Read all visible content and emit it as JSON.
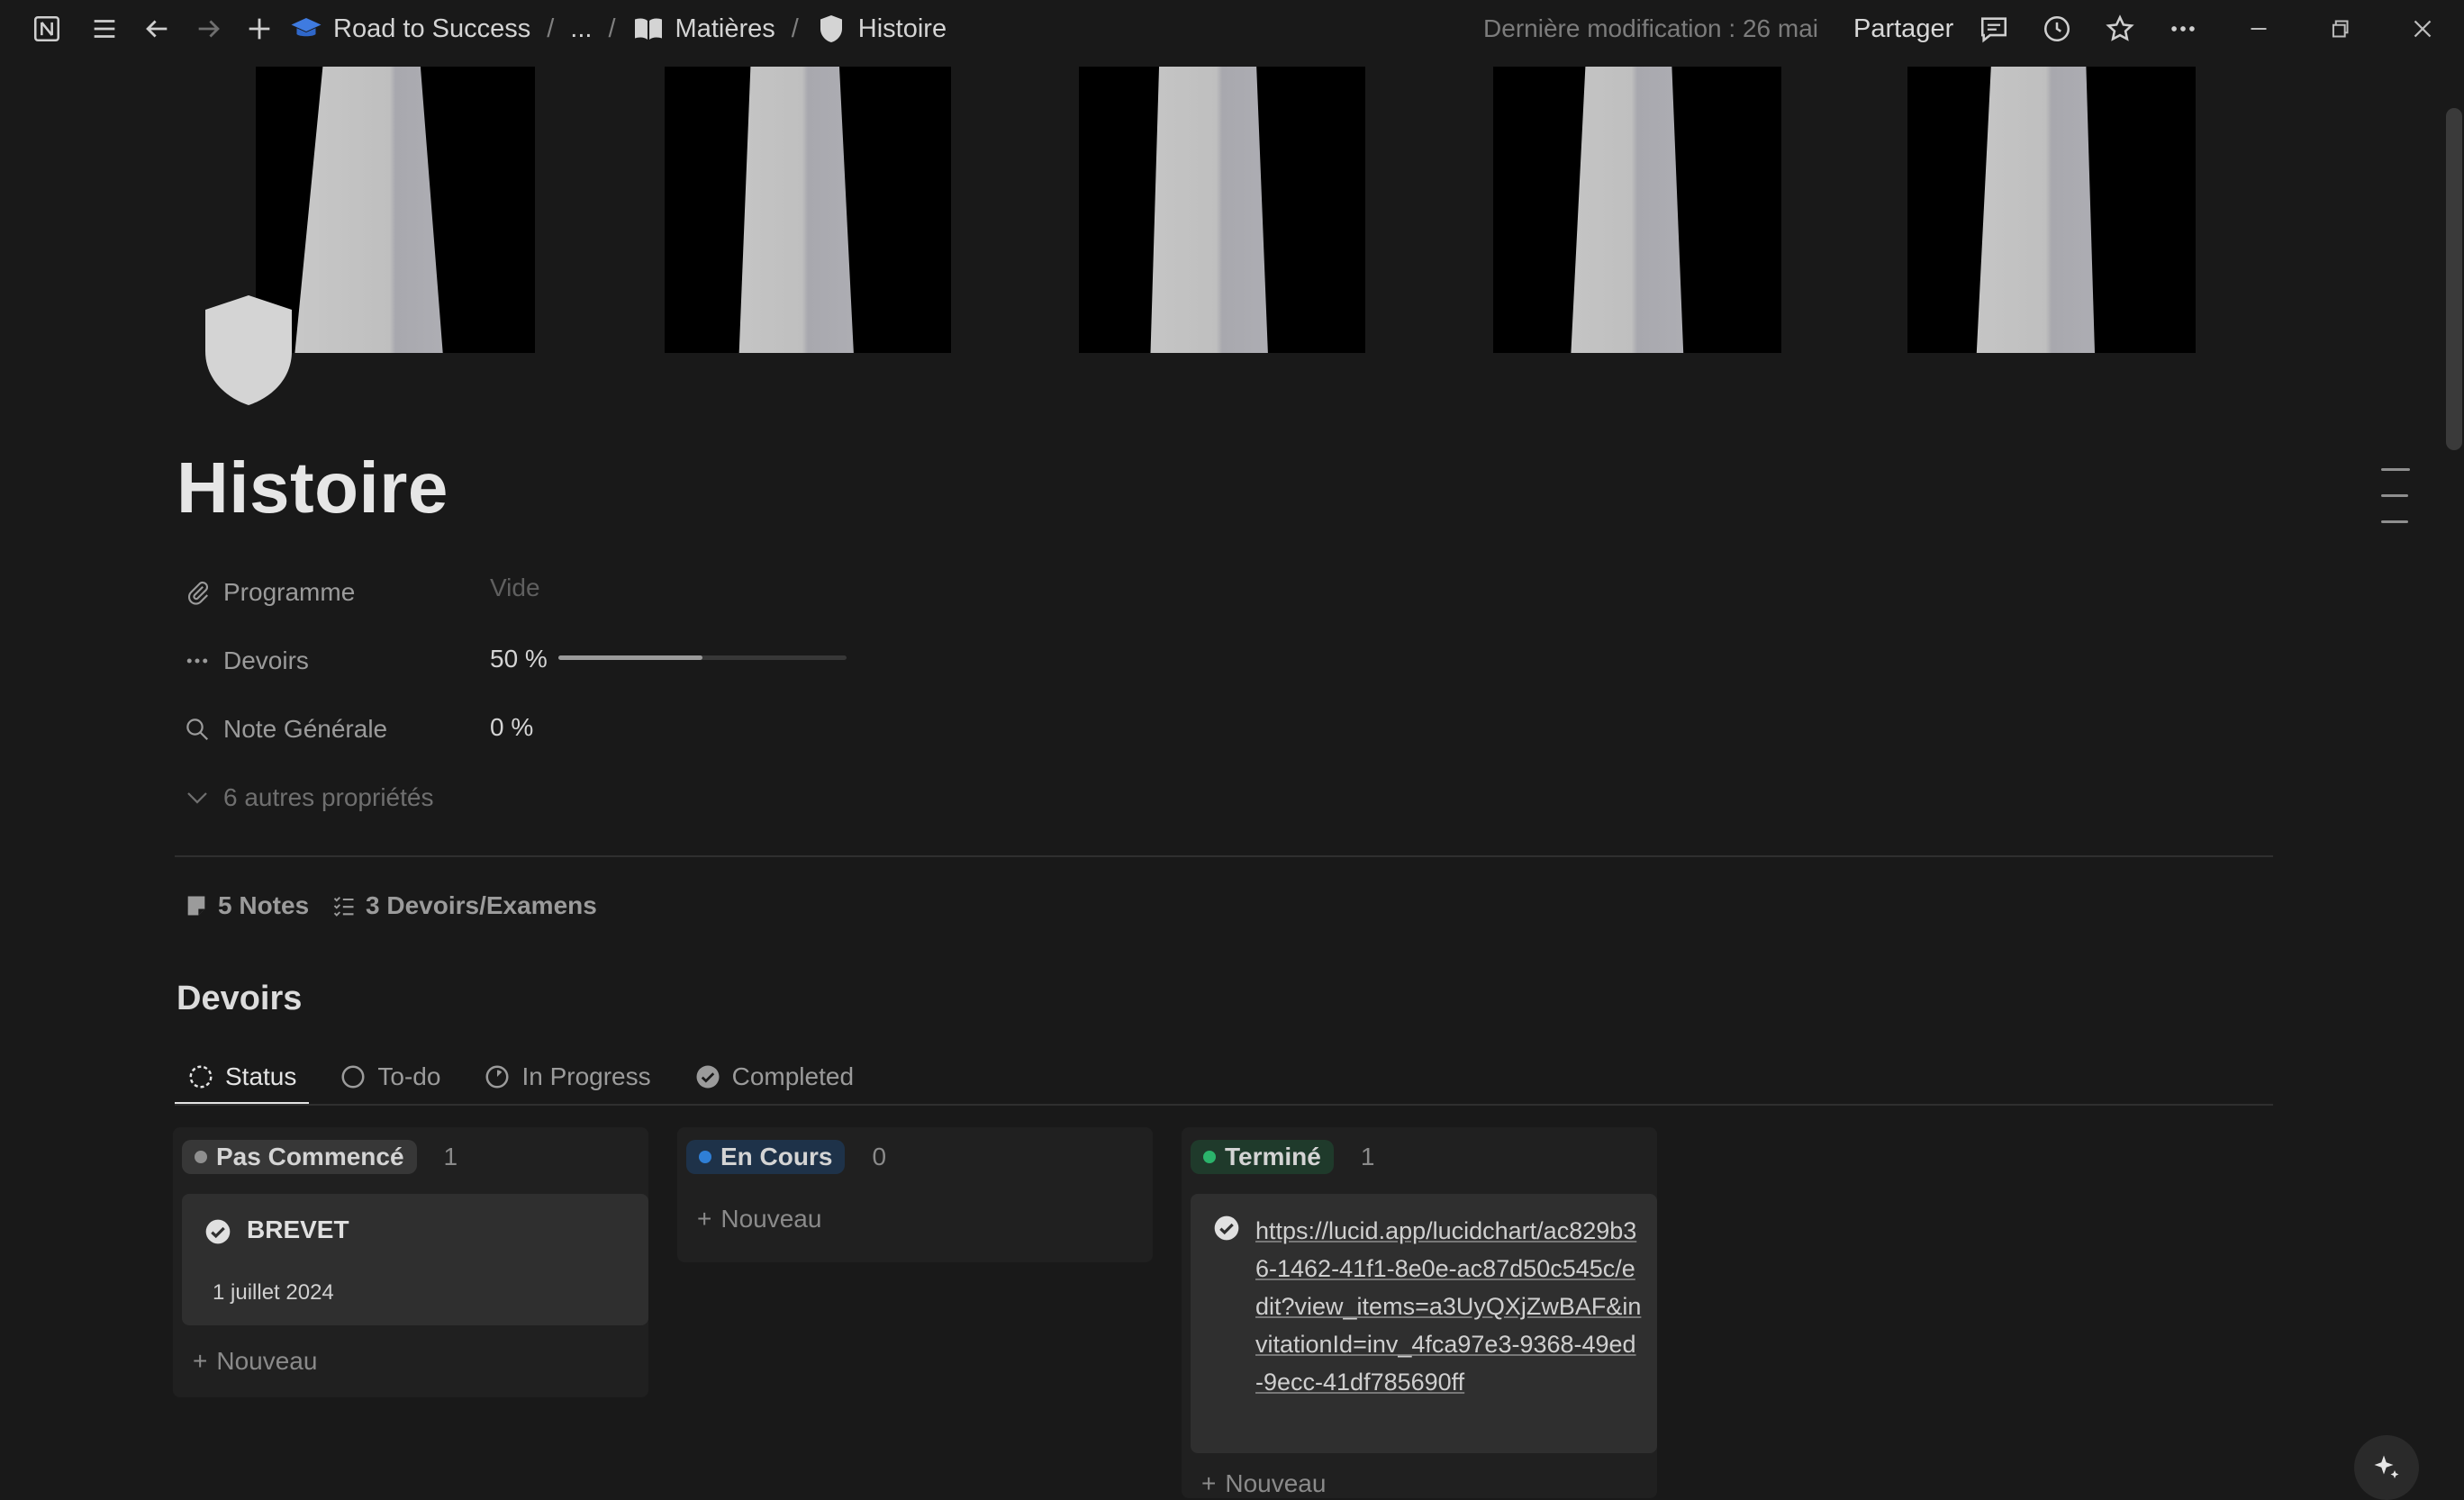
{
  "topbar": {
    "breadcrumbs": [
      "Road to Success",
      "...",
      "Matières",
      "Histoire"
    ],
    "last_modified": "Dernière modification : 26 mai",
    "share_label": "Partager"
  },
  "page": {
    "title": "Histoire",
    "properties": [
      {
        "label": "Programme",
        "value": "Vide",
        "icon": "paperclip-icon"
      },
      {
        "label": "Devoirs",
        "value": "50 %",
        "icon": "dots-icon",
        "progress": 0.5
      },
      {
        "label": "Note Générale",
        "value": "0 %",
        "icon": "search-icon"
      }
    ],
    "more_properties": "6 autres propriétés",
    "relations": [
      {
        "label": "5 Notes",
        "icon": "notes-icon"
      },
      {
        "label": "3 Devoirs/Examens",
        "icon": "checklist-icon"
      }
    ]
  },
  "devoirs": {
    "title": "Devoirs",
    "tabs": [
      {
        "label": "Status",
        "icon": "status-icon",
        "active": true
      },
      {
        "label": "To-do",
        "icon": "circle-icon"
      },
      {
        "label": "In Progress",
        "icon": "half-circle-icon"
      },
      {
        "label": "Completed",
        "icon": "check-circle-icon"
      }
    ],
    "columns": [
      {
        "name": "Pas Commencé",
        "count": "1",
        "color": "#8f8f8f",
        "pill_bg": "#373737",
        "cards": [
          {
            "title": "BREVET",
            "date": "1 juillet 2024"
          }
        ],
        "new_label": "Nouveau"
      },
      {
        "name": "En Cours",
        "count": "0",
        "color": "#2f7fd6",
        "pill_bg": "#1e3249",
        "cards": [],
        "new_label": "Nouveau"
      },
      {
        "name": "Terminé",
        "count": "1",
        "color": "#2bb36b",
        "pill_bg": "#1f3a2b",
        "cards": [
          {
            "title": "https://lucid.app/lucidchart/ac829b36-1462-41f1-8e0e-ac87d50c545c/edit?view_items=a3UyQXjZwBAF&invitationId=inv_4fca97e3-9368-49ed-9ecc-41df785690ff"
          }
        ],
        "new_label": "Nouveau"
      }
    ]
  }
}
